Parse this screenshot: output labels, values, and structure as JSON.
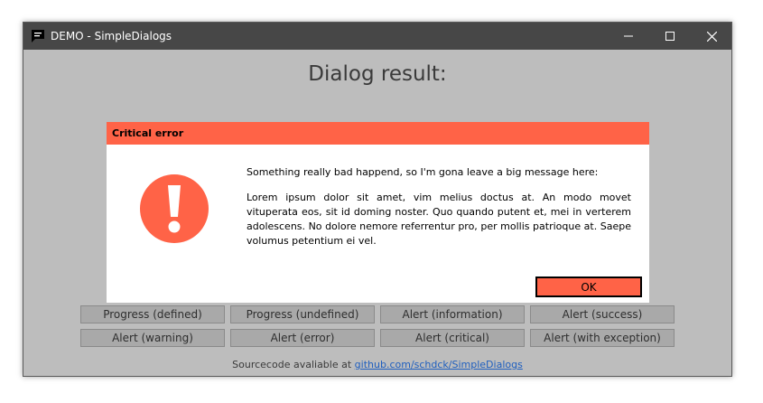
{
  "window": {
    "title": "DEMO - SimpleDialogs"
  },
  "main": {
    "heading": "Dialog result:"
  },
  "dialog": {
    "title": "Critical error",
    "icon": "exclamation-icon",
    "accent_color": "#ff6347",
    "message_lines": [
      "Something really bad happend, so I'm gona leave a big message here:",
      "Lorem ipsum dolor sit amet, vim melius doctus at. An modo movet vituperata eos, sit id doming noster. Quo quando putent et, mei in verterem adolescens. No dolore nemore referrentur pro, per mollis patrioque at. Saepe volumus petentium ei vel."
    ],
    "ok_label": "OK"
  },
  "buttons": [
    "Progress (defined)",
    "Progress (undefined)",
    "Alert (information)",
    "Alert (success)",
    "Alert (warning)",
    "Alert (error)",
    "Alert (critical)",
    "Alert (with exception)"
  ],
  "footer": {
    "prefix": "Sourcecode avaliable at ",
    "link": "github.com/schdck/SimpleDialogs"
  }
}
